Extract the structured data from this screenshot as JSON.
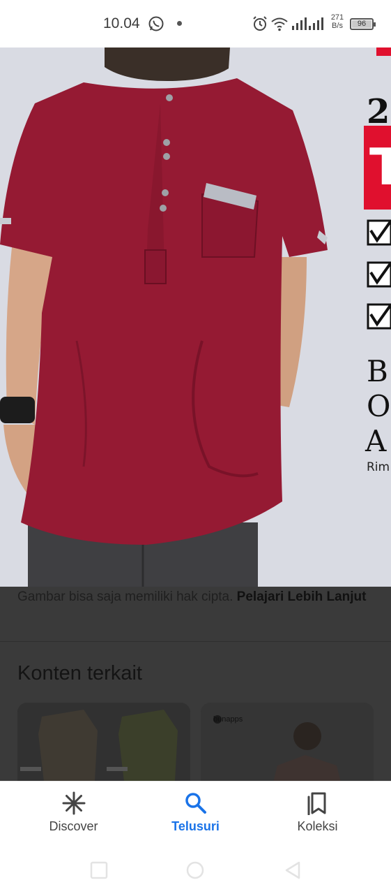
{
  "status_bar": {
    "time": "10.04",
    "net_speed_value": "271",
    "net_speed_unit": "B/s",
    "battery": "96",
    "icons": [
      "whatsapp-icon",
      "dot-icon",
      "alarm-icon",
      "wifi-icon",
      "signal-icon",
      "signal-icon",
      "battery-icon"
    ]
  },
  "image": {
    "subject": "maroon short-sleeve kurta shirt",
    "banner_partial_text": [
      "2",
      "T",
      "B",
      "O",
      "A",
      "Rim"
    ],
    "colors": {
      "shirt": "#951a33",
      "background": "#d9dbe3",
      "banner_red": "#e0102e"
    }
  },
  "content": {
    "copyright_text": "Gambar bisa saja memiliki hak cipta.",
    "learn_more": "Pelajari Lebih Lanjut",
    "related_title": "Konten terkait",
    "card_2_logo": "bunapps"
  },
  "bottom_nav": {
    "items": [
      {
        "label": "Discover",
        "icon": "asterisk-icon",
        "active": false
      },
      {
        "label": "Telusuri",
        "icon": "search-icon",
        "active": true
      },
      {
        "label": "Koleksi",
        "icon": "collections-icon",
        "active": false
      }
    ],
    "accent_color": "#1a73e8"
  },
  "system_nav": {
    "buttons": [
      "recent-apps-button",
      "home-button",
      "back-button"
    ]
  }
}
